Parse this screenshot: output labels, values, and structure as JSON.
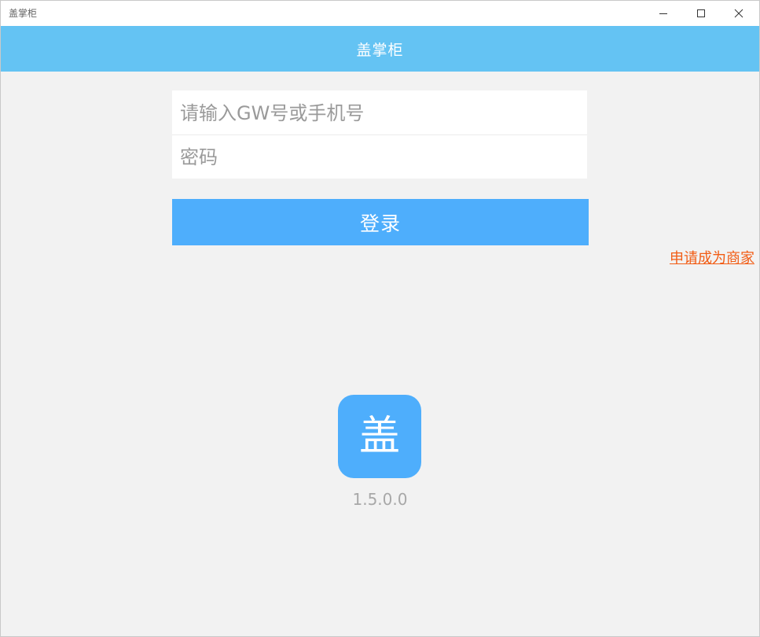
{
  "window": {
    "title": "盖掌柜",
    "controls": {
      "minimize_icon": "minimize-icon",
      "maximize_icon": "maximize-icon",
      "close_icon": "close-icon"
    }
  },
  "header": {
    "title": "盖掌柜",
    "background_color": "#64c3f3"
  },
  "login_form": {
    "username_placeholder": "请输入GW号或手机号",
    "username_value": "",
    "password_placeholder": "密码",
    "password_value": "",
    "login_label": "登录",
    "login_color": "#4eaefc"
  },
  "merchant_link": {
    "label": "申请成为商家",
    "color": "#f25c14"
  },
  "logo": {
    "character": "盖",
    "version": "1.5.0.0"
  }
}
